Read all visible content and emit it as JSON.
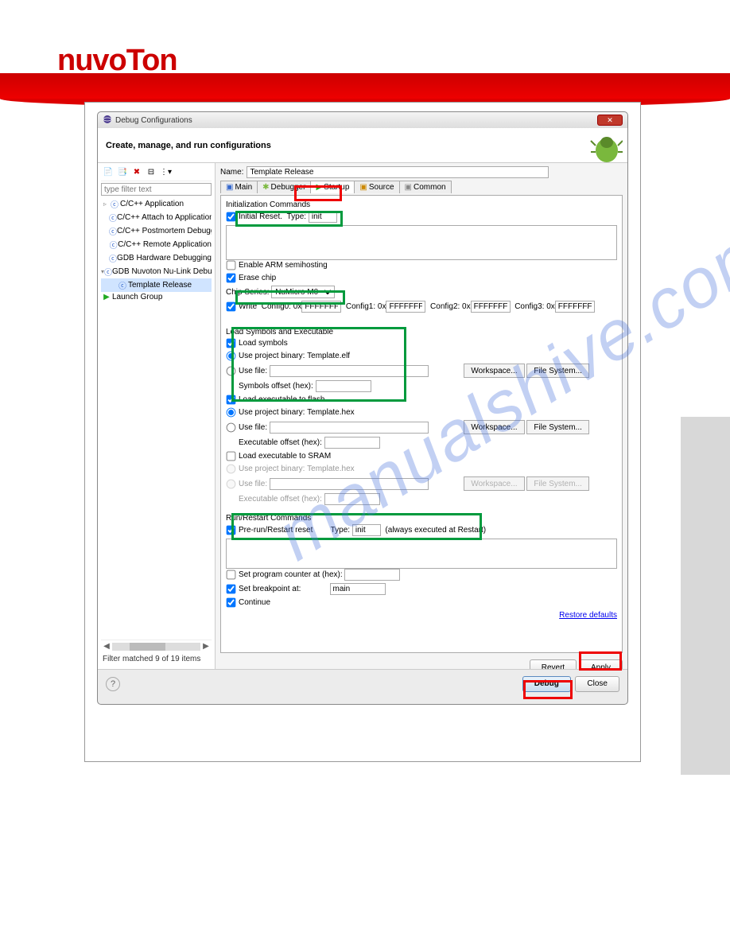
{
  "brand": "nuvoTon",
  "dialog": {
    "title": "Debug Configurations",
    "header": "Create, manage, and run configurations"
  },
  "filter": {
    "placeholder": "type filter text",
    "status": "Filter matched 9 of 19 items"
  },
  "tree": {
    "items": [
      {
        "label": "C/C++ Application",
        "expand": "▹"
      },
      {
        "label": "C/C++ Attach to Application"
      },
      {
        "label": "C/C++ Postmortem Debugger"
      },
      {
        "label": "C/C++ Remote Application"
      },
      {
        "label": "GDB Hardware Debugging"
      },
      {
        "label": "GDB Nuvoton Nu-Link Debuggin",
        "expand": "▾"
      },
      {
        "label": "Template Release"
      },
      {
        "label": "Launch Group"
      }
    ]
  },
  "name": {
    "label": "Name:",
    "value": "Template Release"
  },
  "tabs": {
    "main": "Main",
    "debugger": "Debugger",
    "startup": "Startup",
    "source": "Source",
    "common": "Common"
  },
  "init": {
    "section": "Initialization Commands",
    "initialReset": "Initial Reset.",
    "typeLabel": "Type:",
    "typeValue": "init",
    "semihosting": "Enable ARM semihosting",
    "eraseChip": "Erase chip",
    "chipSeriesLabel": "Chip Series:",
    "chipSeriesValue": "NuMicro M0",
    "write": "Write",
    "c0l": "Config0: 0x",
    "c0v": "FFFFFFFF",
    "c1l": "Config1: 0x",
    "c1v": "FFFFFFFF",
    "c2l": "Config2: 0x",
    "c2v": "FFFFFFFF",
    "c3l": "Config3: 0x",
    "c3v": "FFFFFFFF"
  },
  "load": {
    "section": "Load Symbols and Executable",
    "loadSymbols": "Load symbols",
    "useProjectBinary": "Use project binary:",
    "templateElf": "Template.elf",
    "useFile": "Use file:",
    "workspace": "Workspace...",
    "fileSystem": "File System...",
    "symbolsOffset": "Symbols offset (hex):",
    "loadExecFlash": "Load executable to flash",
    "templateHex": "Template.hex",
    "execOffset": "Executable offset (hex):",
    "loadExecSram": "Load executable to SRAM"
  },
  "run": {
    "section": "Run/Restart Commands",
    "prerun": "Pre-run/Restart reset",
    "typeLabel": "Type:",
    "typeValue": "init",
    "note": "(always executed at Restart)",
    "setPC": "Set program counter at (hex):",
    "setBP": "Set breakpoint at:",
    "bpValue": "main",
    "continue": "Continue"
  },
  "buttons": {
    "restore": "Restore defaults",
    "revert": "Revert",
    "apply": "Apply",
    "debug": "Debug",
    "close": "Close"
  },
  "watermark": "manualshive.com"
}
